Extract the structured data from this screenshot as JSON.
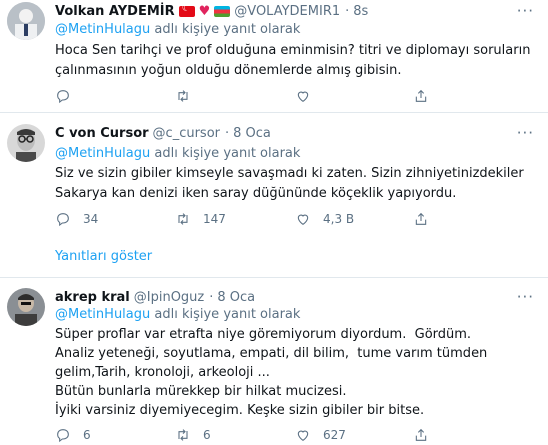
{
  "tweets": [
    {
      "name": "Volkan AYDEMİR",
      "handle": "@VOLAYDEMIR1",
      "time": "8s",
      "reply_mention": "@MetinHulagu",
      "reply_suffix": "adlı kişiye yanıt olarak",
      "lines": [
        "Hoca Sen tarihçi ve prof olduğuna eminmisin? titri ve diplomayı soruların",
        "çalınmasının yoğun olduğu dönemlerde almış gibisin."
      ],
      "replies": "",
      "retweets": "",
      "likes": ""
    },
    {
      "name": "C von Cursor",
      "handle": "@c_cursor",
      "time": "8 Oca",
      "reply_mention": "@MetinHulagu",
      "reply_suffix": "adlı kişiye yanıt olarak",
      "lines": [
        "Siz ve sizin gibiler kimseyle savaşmadı ki zaten. Sizin zihniyetinizdekiler",
        "Sakarya kan denizi iken saray düğününde köçeklik yapıyordu."
      ],
      "replies": "34",
      "retweets": "147",
      "likes": "4,3 B"
    },
    {
      "name": "akrep kral",
      "handle": "@IpinOguz",
      "time": "8 Oca",
      "reply_mention": "@MetinHulagu",
      "reply_suffix": "adlı kişiye yanıt olarak",
      "lines": [
        "Süper proflar var etrafta niye göremiyorum diyordum.  Gördüm.",
        "Analiz yeteneği, soyutlama, empati, dil bilim,  tume varım tümden",
        "gelim,Tarih, kronoloji, arkeoloji ...",
        "Bütün bunlarla mürekkep bir hilkat mucizesi.",
        "İyiki varsiniz diyemiyecegim. Keşke sizin gibiler bir bitse."
      ],
      "replies": "6",
      "retweets": "6",
      "likes": "627"
    }
  ],
  "show_replies_label": "Yanıtları göster",
  "dot": "·",
  "more_label": "···",
  "colors": {
    "accent": "#1da1f2",
    "secondary": "#5b7083",
    "divider": "#e1e8ed"
  }
}
